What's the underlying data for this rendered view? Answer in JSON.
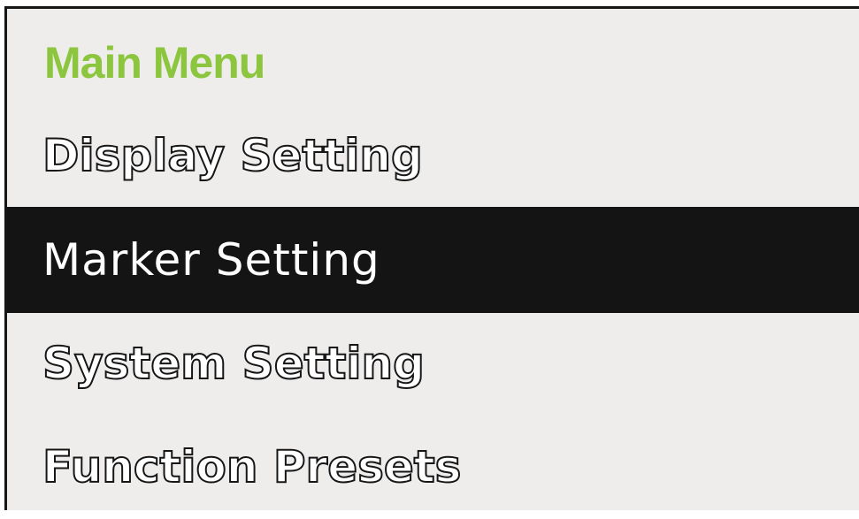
{
  "menu": {
    "title": "Main Menu",
    "items": [
      {
        "label": "Display  Setting",
        "selected": false
      },
      {
        "label": "Marker Setting",
        "selected": true
      },
      {
        "label": "System Setting",
        "selected": false
      },
      {
        "label": "Function Presets",
        "selected": false
      }
    ]
  },
  "colors": {
    "title": "#8cc63f",
    "panel_background": "#efedec",
    "selected_background": "#141414",
    "selected_text": "#ffffff",
    "outline_fill": "#ffffff",
    "outline_stroke": "#161616"
  }
}
